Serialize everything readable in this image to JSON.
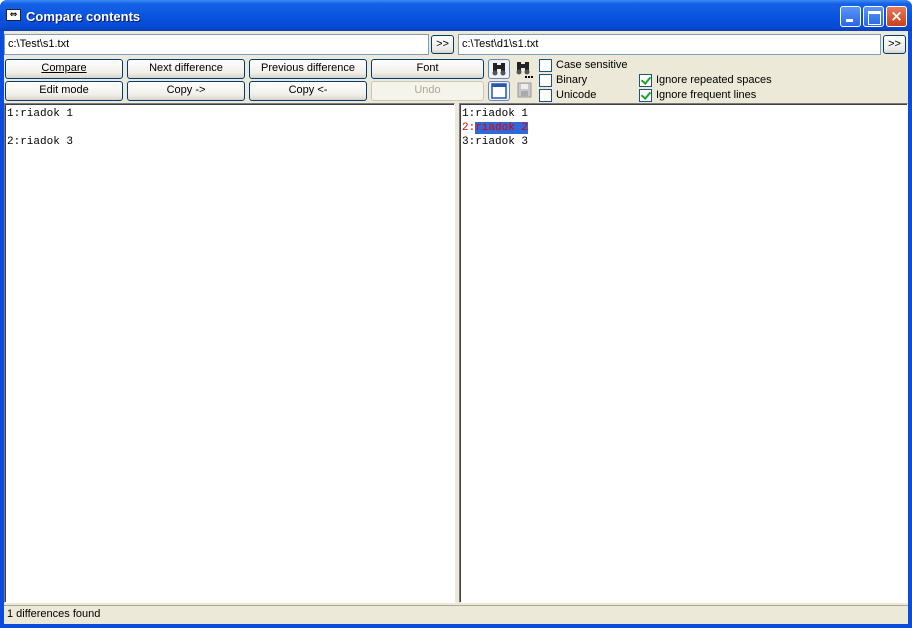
{
  "window": {
    "title": "Compare contents"
  },
  "left": {
    "path": "c:\\Test\\s1.txt",
    "browse": ">>"
  },
  "right": {
    "path": "c:\\Test\\d1\\s1.txt",
    "browse": ">>"
  },
  "buttons": {
    "compare": "Compare",
    "next_difference": "Next difference",
    "previous_difference": "Previous difference",
    "font": "Font",
    "edit_mode": "Edit mode",
    "copy_right": "Copy ->",
    "copy_left": "Copy <-",
    "undo": "Undo"
  },
  "options": {
    "case_sensitive": {
      "label": "Case sensitive",
      "checked": false
    },
    "binary": {
      "label": "Binary",
      "checked": false
    },
    "unicode": {
      "label": "Unicode",
      "checked": false
    },
    "ignore_repeated_spaces": {
      "label": "Ignore repeated spaces",
      "checked": true
    },
    "ignore_frequent_lines": {
      "label": "Ignore frequent lines",
      "checked": true
    }
  },
  "left_lines": [
    "1:riadok 1",
    "",
    "2:riadok 3"
  ],
  "right_lines": [
    {
      "num": "1:",
      "text": "riadok 1",
      "diff": false
    },
    {
      "num": "2:",
      "text": "riadok 2",
      "diff": true
    },
    {
      "num": "3:",
      "text": "riadok 3",
      "diff": false
    }
  ],
  "status": "1 differences found",
  "colors": {
    "diff_text": "#e00000",
    "diff_highlight": "#3068d8",
    "titlebar": "#0a55e0"
  },
  "icons": [
    "app-icon",
    "minimize-icon",
    "maximize-icon",
    "close-icon",
    "binoculars-icon",
    "binoculars-dots-icon",
    "window-icon",
    "save-icon"
  ]
}
